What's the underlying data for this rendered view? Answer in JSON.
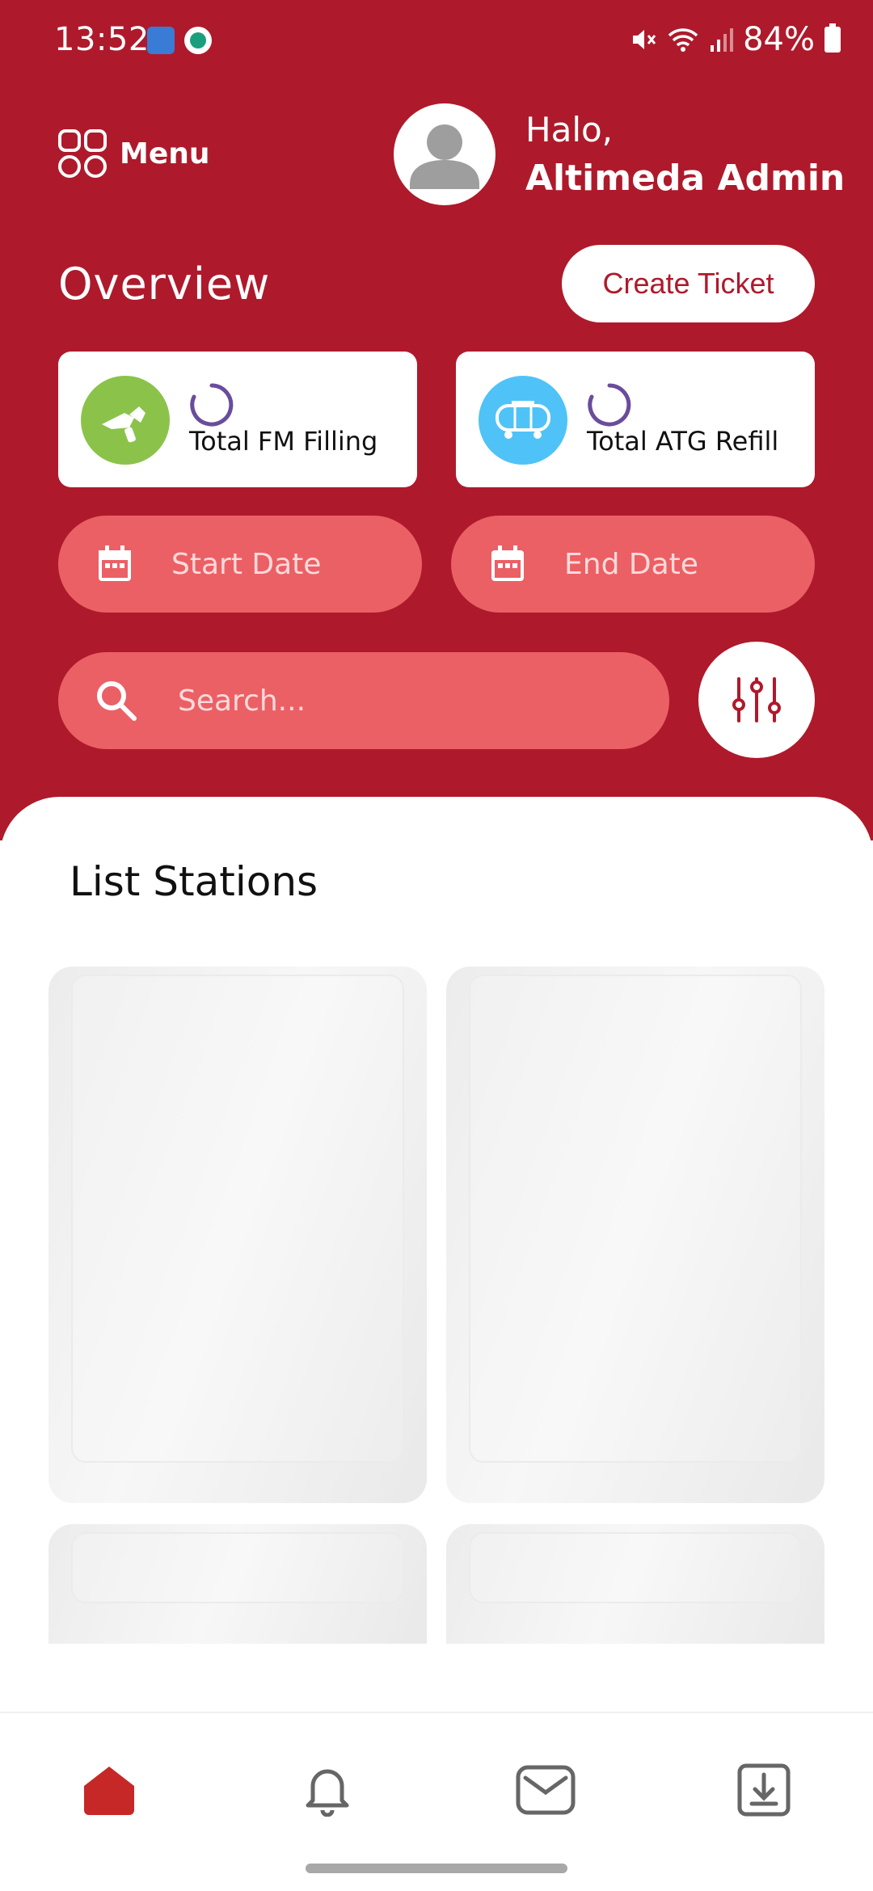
{
  "status_bar": {
    "time": "13:52",
    "battery": "84%"
  },
  "header": {
    "menu_label": "Menu",
    "greeting": "Halo,",
    "user_name": "Altimeda Admin"
  },
  "overview": {
    "title": "Overview",
    "create_ticket_label": "Create Ticket",
    "cards": [
      {
        "label": "Total FM Filling",
        "icon": "fuel-nozzle-icon",
        "color": "#8bc34a"
      },
      {
        "label": "Total ATG Refill",
        "icon": "tanker-truck-icon",
        "color": "#4fc3f7"
      }
    ]
  },
  "filters": {
    "start_date_placeholder": "Start Date",
    "end_date_placeholder": "End Date",
    "search_placeholder": "Search..."
  },
  "stations": {
    "title": "List Stations"
  },
  "nav": {
    "items": [
      "home-icon",
      "bell-icon",
      "mail-icon",
      "download-icon"
    ],
    "active": "home-icon"
  },
  "colors": {
    "brand": "#ae1a2b",
    "pill": "#eb6065",
    "accent_active": "#c62828"
  }
}
